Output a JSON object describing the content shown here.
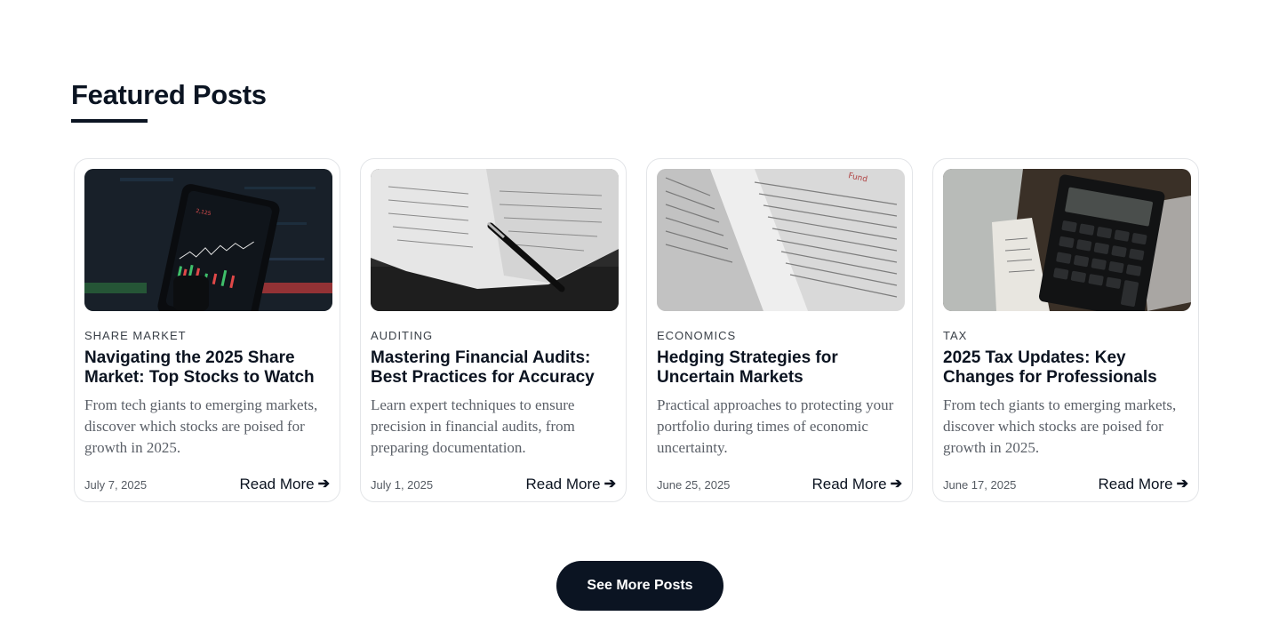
{
  "section": {
    "title": "Featured Posts",
    "accent_color": "#0b1422"
  },
  "posts": [
    {
      "image": "stock-trading-phone-image",
      "category": "SHARE MARKET",
      "title": "Navigating the 2025 Share Market: Top Stocks to Watch",
      "excerpt": "From tech giants to emerging markets, discover which stocks are poised for growth in 2025.",
      "date": "July 7, 2025",
      "read_more": "Read More"
    },
    {
      "image": "audit-paper-pen-image",
      "category": "AUDITING",
      "title": "Mastering Financial Audits: Best Practices for Accuracy",
      "excerpt": "Learn expert techniques to ensure precision in financial audits, from preparing documentation.",
      "date": "July 1, 2025",
      "read_more": "Read More"
    },
    {
      "image": "financial-newspaper-image",
      "category": "ECONOMICS",
      "title": "Hedging Strategies for Uncertain Markets",
      "excerpt": "Practical approaches to protecting your portfolio during times of economic uncertainty.",
      "date": "June 25, 2025",
      "read_more": "Read More"
    },
    {
      "image": "calculator-receipts-image",
      "category": "TAX",
      "title": "2025 Tax Updates: Key Changes for Professionals",
      "excerpt": "From tech giants to emerging markets, discover which stocks are poised for growth in 2025.",
      "date": "June 17, 2025",
      "read_more": "Read More"
    }
  ],
  "see_more_label": "See More Posts",
  "icons": {
    "read_more_arrow": "arrow-right-icon"
  }
}
